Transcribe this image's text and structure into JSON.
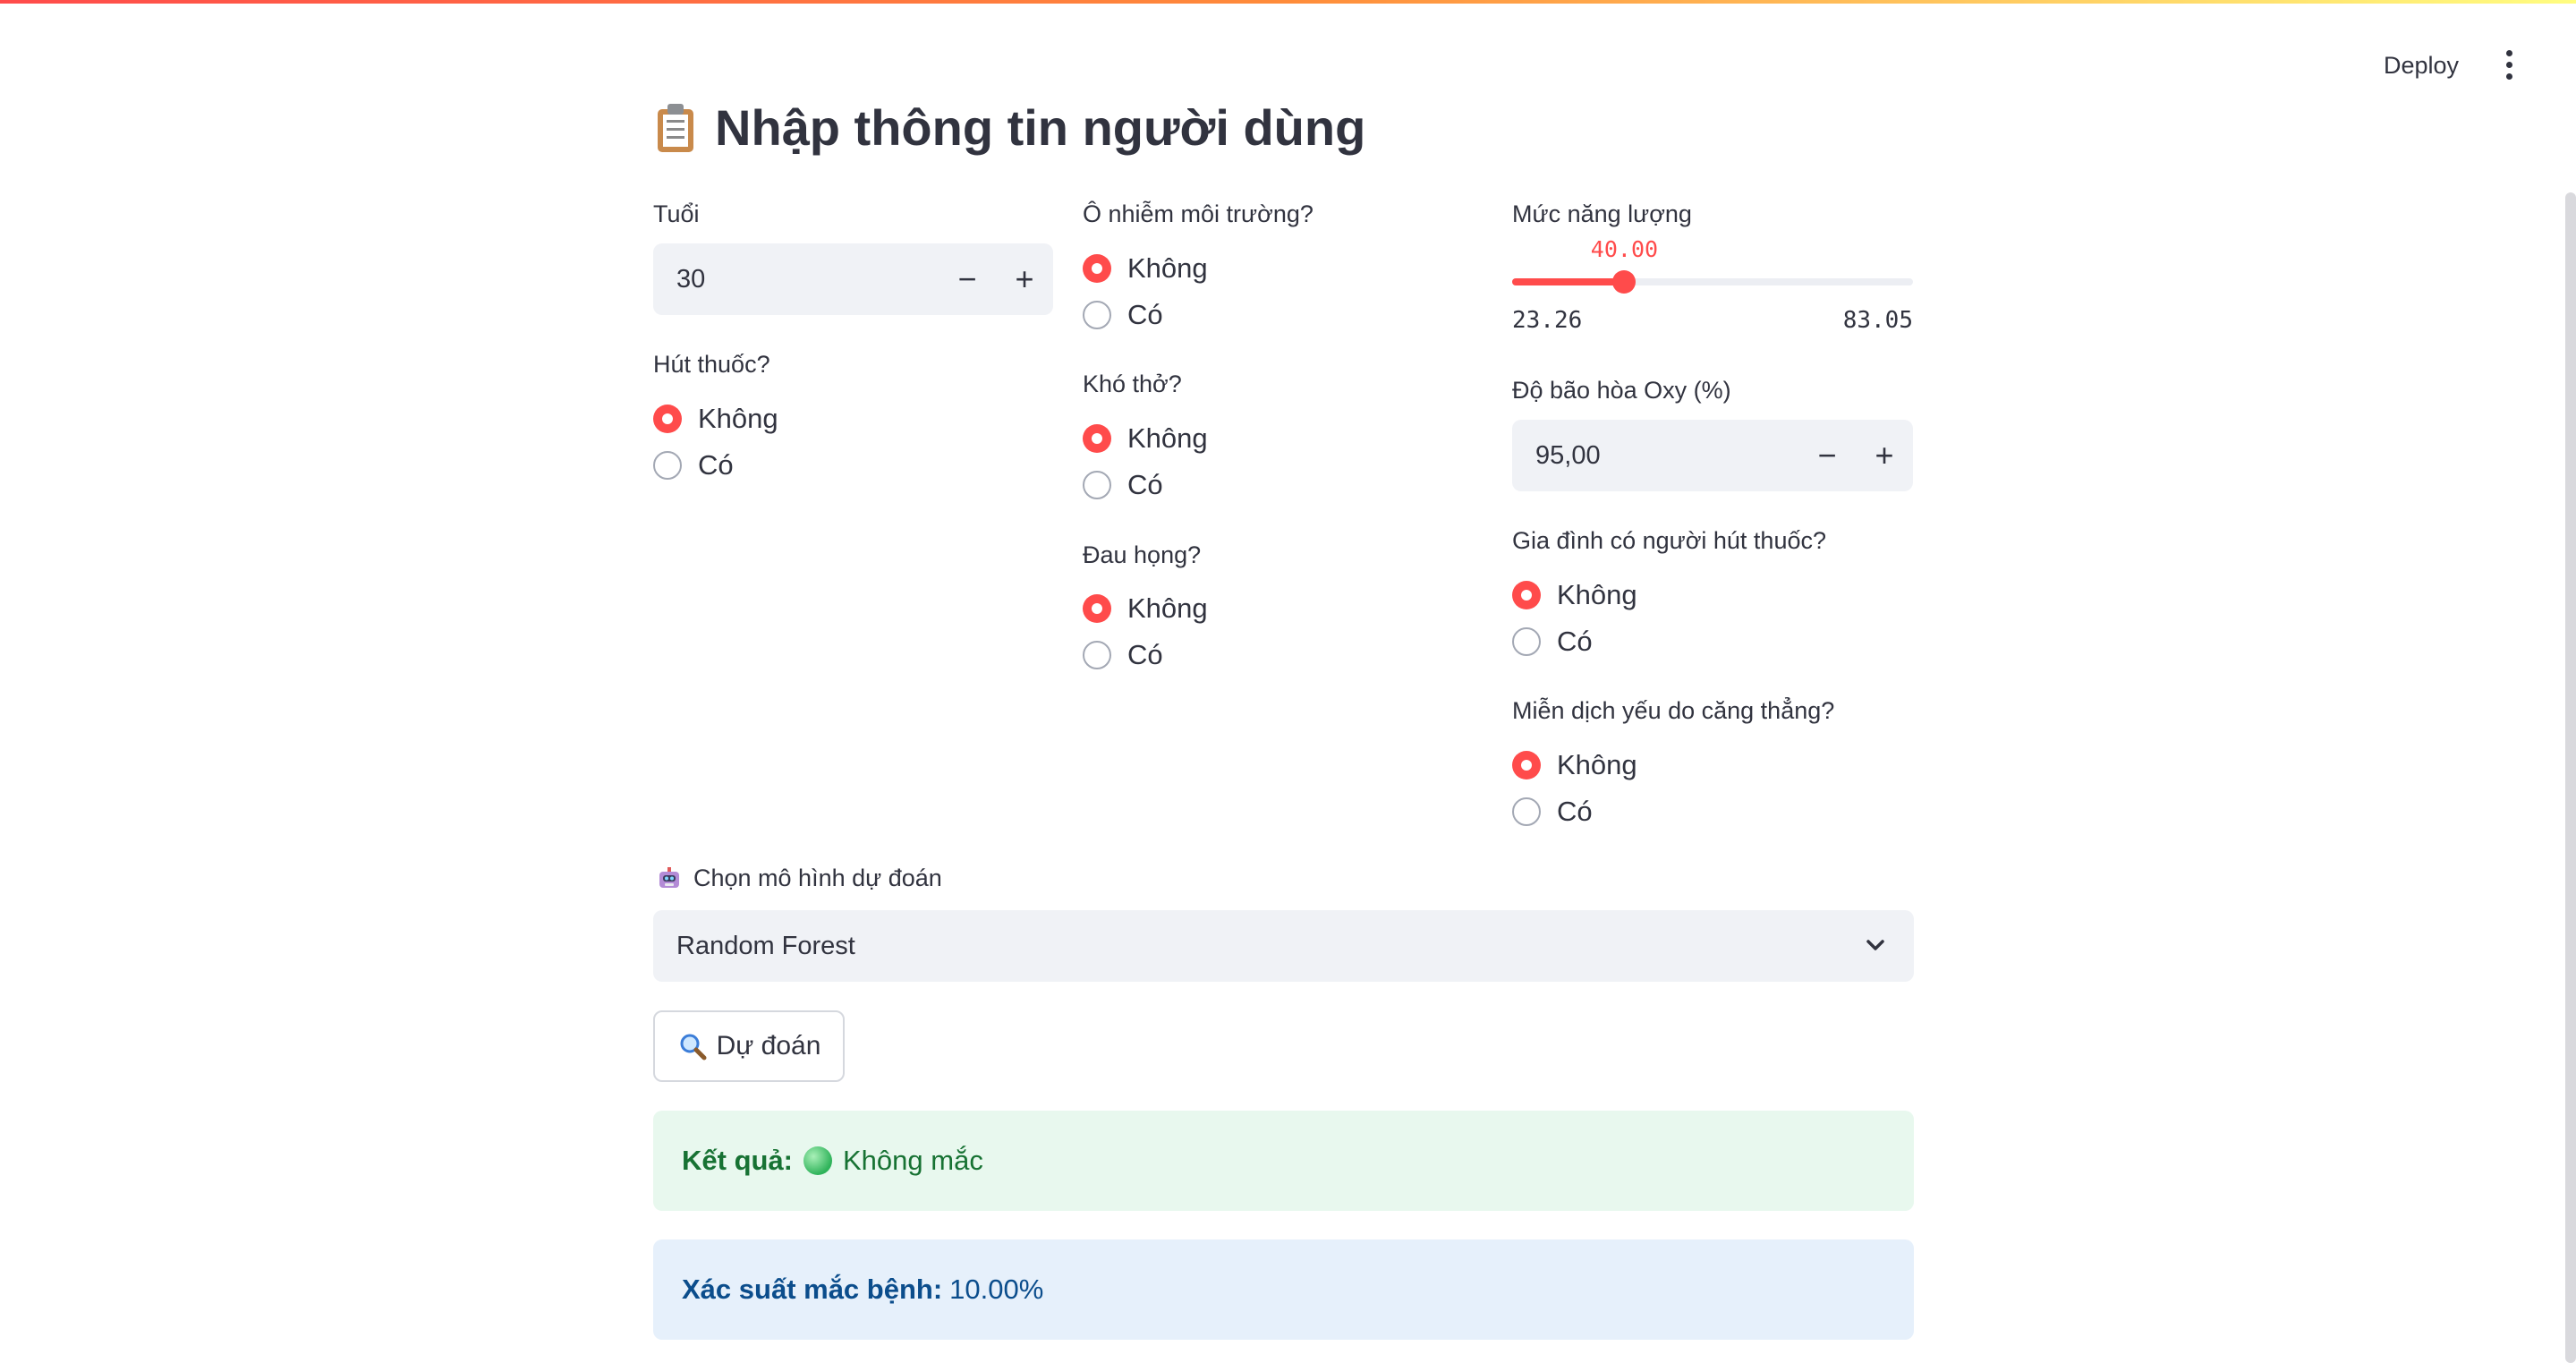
{
  "header": {
    "deploy_label": "Deploy",
    "menu_icon": "vertical-dots-icon"
  },
  "page": {
    "title": "Nhập thông tin người dùng",
    "title_icon": "clipboard-icon"
  },
  "form": {
    "age": {
      "label": "Tuổi",
      "value": "30"
    },
    "smoking": {
      "label": "Hút thuốc?",
      "options": [
        "Không",
        "Có"
      ],
      "selected": "Không"
    },
    "pollution": {
      "label": "Ô nhiễm môi trường?",
      "options": [
        "Không",
        "Có"
      ],
      "selected": "Không"
    },
    "breathing": {
      "label": "Khó thở?",
      "options": [
        "Không",
        "Có"
      ],
      "selected": "Không"
    },
    "sore_throat": {
      "label": "Đau họng?",
      "options": [
        "Không",
        "Có"
      ],
      "selected": "Không"
    },
    "energy": {
      "label": "Mức năng lượng",
      "value": "40.00",
      "min": "23.26",
      "max": "83.05"
    },
    "oxygen": {
      "label": "Độ bão hòa Oxy (%)",
      "value": "95,00"
    },
    "family_smoking": {
      "label": "Gia đình có người hút thuốc?",
      "options": [
        "Không",
        "Có"
      ],
      "selected": "Không"
    },
    "stress_immune": {
      "label": "Miễn dịch yếu do căng thẳng?",
      "options": [
        "Không",
        "Có"
      ],
      "selected": "Không"
    }
  },
  "model_select": {
    "label": "Chọn mô hình dự đoán",
    "label_icon": "robot-icon",
    "value": "Random Forest"
  },
  "predict_button": {
    "label": "Dự đoán",
    "icon": "magnifier-icon"
  },
  "result": {
    "label": "Kết quả:",
    "icon": "green-circle-icon",
    "value": "Không mắc"
  },
  "probability": {
    "label": "Xác suất mắc bệnh:",
    "value": "10.00%"
  },
  "colors": {
    "accent": "#ff4b4b",
    "success_bg": "#e8f8ee",
    "info_bg": "#e6f0fb"
  }
}
